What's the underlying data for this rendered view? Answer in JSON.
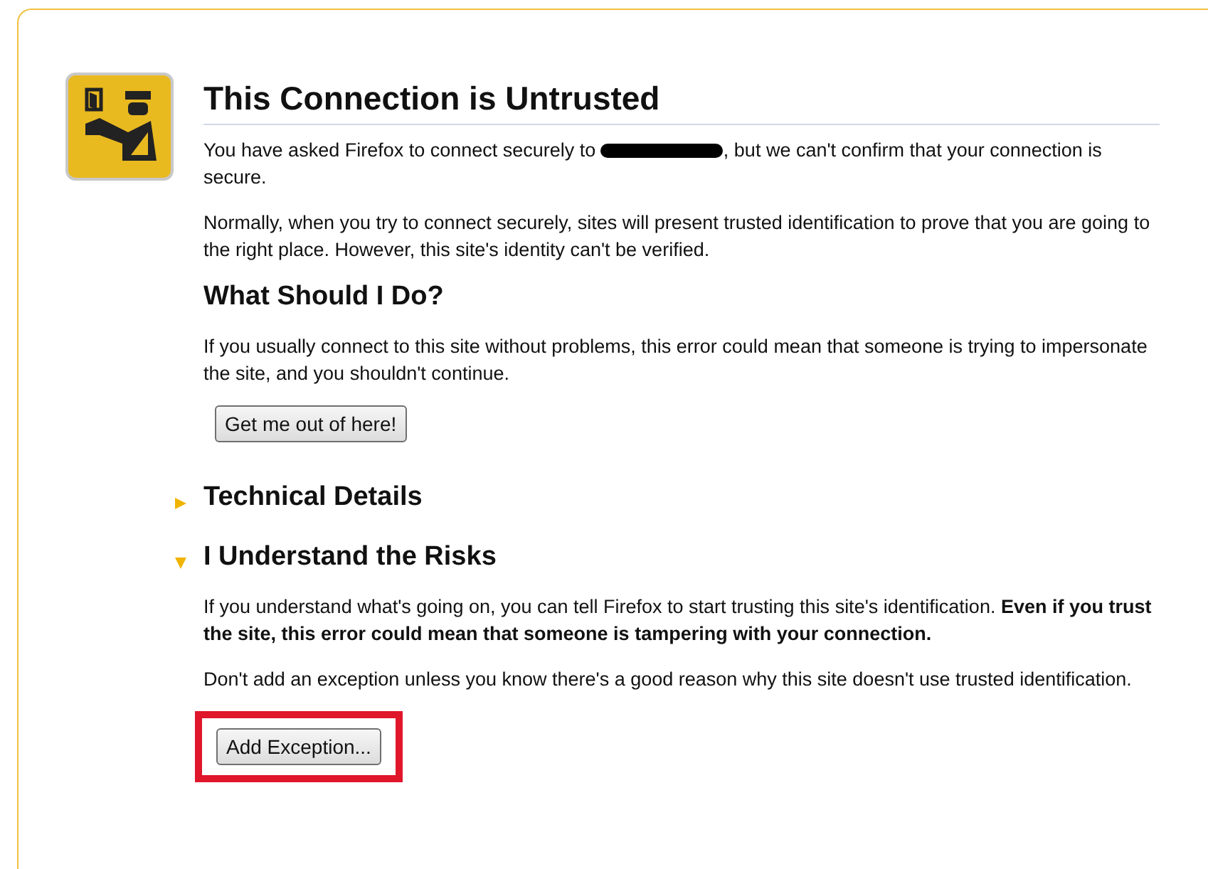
{
  "title": "This Connection is Untrusted",
  "intro": {
    "before": "You have asked Firefox to connect securely to ",
    "redacted": true,
    "after": ", but we can't confirm that your connection is secure."
  },
  "paragraphs": [
    "Normally, when you try to connect securely, sites will present trusted identification to prove that you are going to the right place. However, this site's identity can't be verified."
  ],
  "what_to_do": {
    "heading": "What Should I Do?",
    "text": "If you usually connect to this site without problems, this error could mean that someone is trying to impersonate the site, and you shouldn't continue.",
    "button": "Get me out of here!"
  },
  "sections": [
    {
      "heading": "Technical Details",
      "expanded": false
    },
    {
      "heading": "I Understand the Risks",
      "expanded": true,
      "paragraphs": [
        "If you understand what's going on, you can tell Firefox to start trusting this site's identification. **Even if you trust the site, this error could mean that someone is tampering with your connection.**",
        "Don't add an exception unless you know there's a good reason why this site doesn't use trusted identification."
      ],
      "button": {
        "label": "Add Exception...",
        "highlighted": true
      }
    }
  ]
}
